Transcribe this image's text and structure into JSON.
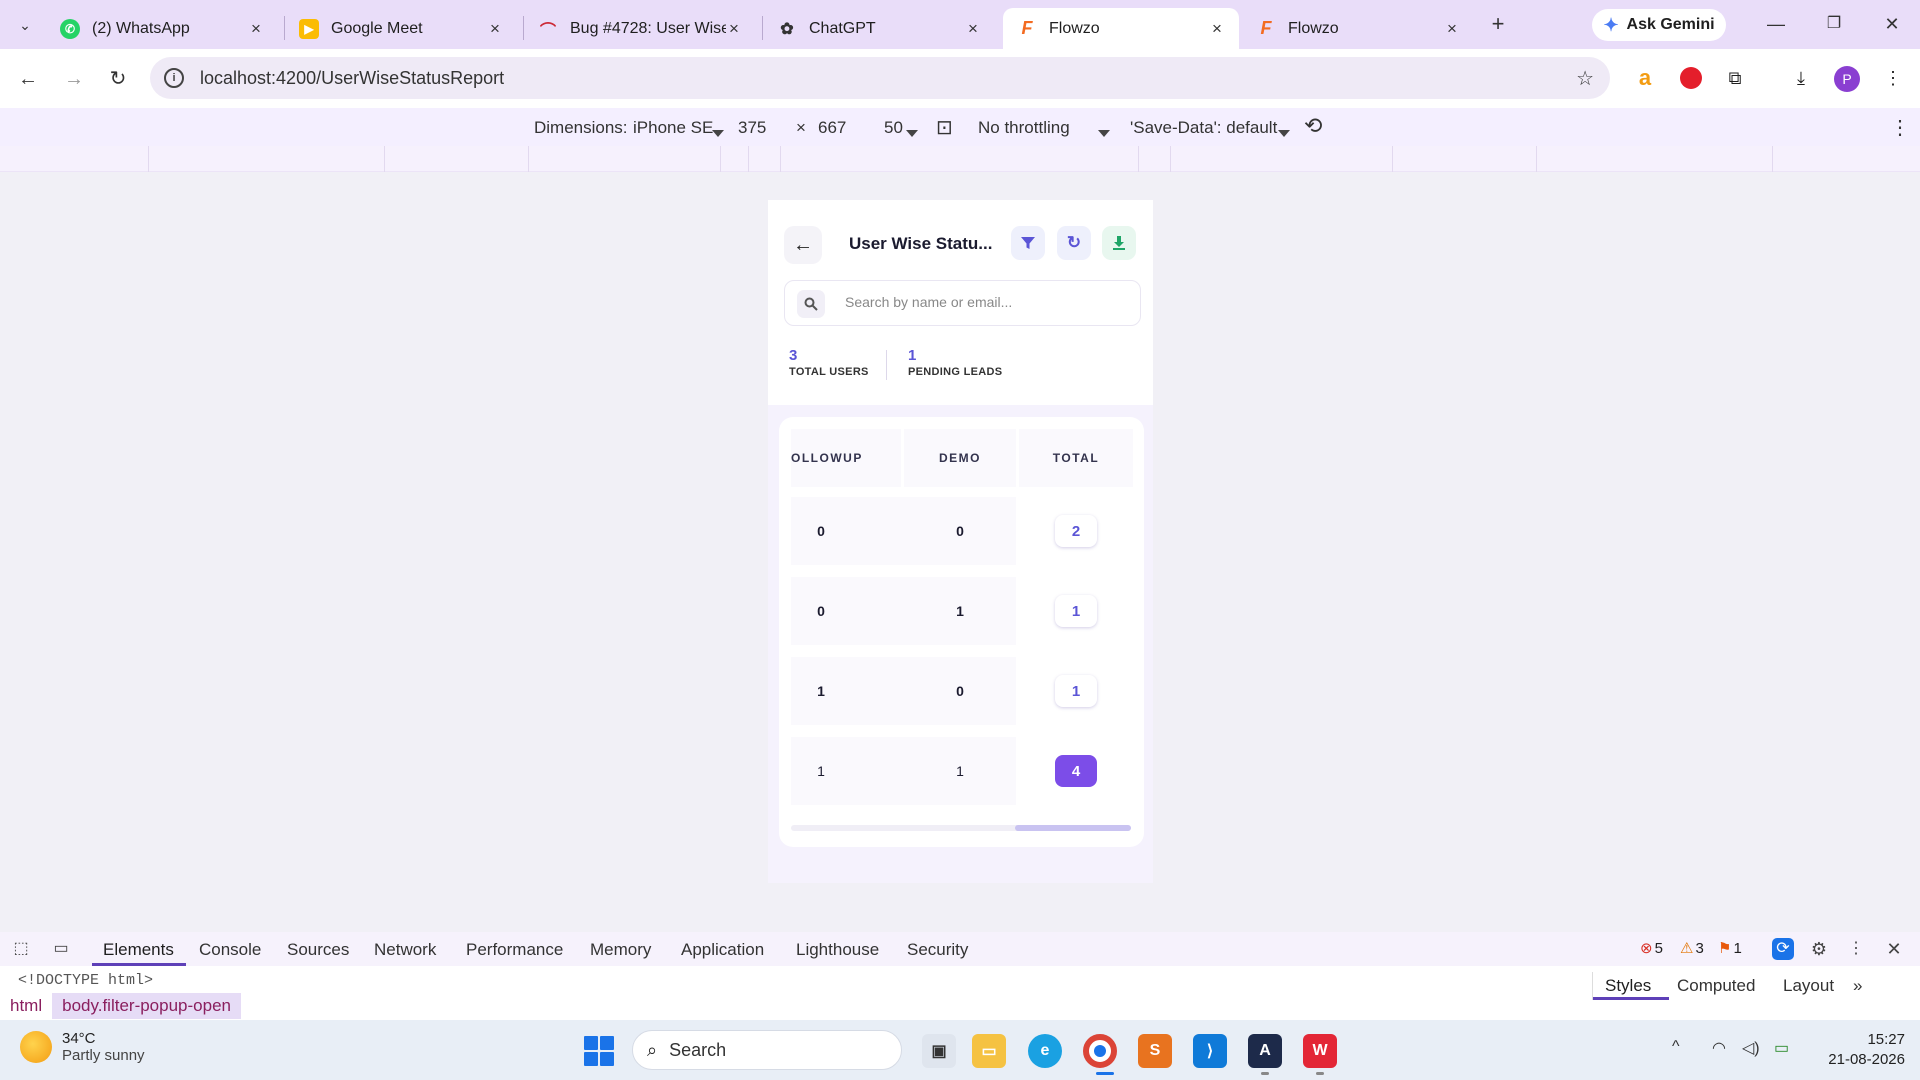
{
  "browser": {
    "tabs": [
      {
        "title": "(2) WhatsApp",
        "icon": "whatsapp-icon",
        "color": "#25d366"
      },
      {
        "title": "Google Meet",
        "icon": "meet-icon",
        "color": "#fbbc04"
      },
      {
        "title": "Bug #4728: User Wise",
        "icon": "azure-devops-icon",
        "color": "#cc2936"
      },
      {
        "title": "ChatGPT",
        "icon": "chatgpt-icon",
        "color": "#333333"
      },
      {
        "title": "Flowzo",
        "icon": "flowzo-icon",
        "color": "#f36b21",
        "active": true
      },
      {
        "title": "Flowzo",
        "icon": "flowzo-icon",
        "color": "#f36b21"
      }
    ],
    "gemini_label": "Ask Gemini",
    "url": "localhost:4200/UserWiseStatusReport"
  },
  "device_toolbar": {
    "dimensions_label": "Dimensions:",
    "device": "iPhone SE",
    "width": "375",
    "times": "×",
    "height": "667",
    "zoom": "50",
    "throttling": "No throttling",
    "save_data": "'Save-Data': default"
  },
  "app": {
    "title": "User Wise Statu...",
    "search_placeholder": "Search by name or email...",
    "stats": [
      {
        "value": "3",
        "label": "TOTAL USERS"
      },
      {
        "value": "1",
        "label": "PENDING LEADS"
      }
    ],
    "table": {
      "columns": [
        "OLLOWUP",
        "DEMO",
        "TOTAL"
      ],
      "rows": [
        {
          "followup": "0",
          "demo": "0",
          "total": "2"
        },
        {
          "followup": "0",
          "demo": "1",
          "total": "1"
        },
        {
          "followup": "1",
          "demo": "0",
          "total": "1"
        },
        {
          "followup": "1",
          "demo": "1",
          "total": "4"
        }
      ]
    },
    "colors": {
      "accent": "#5b55d6",
      "total_highlight": "#7c4de8",
      "refresh": "#5b55d6",
      "download": "#1fa567"
    }
  },
  "devtools": {
    "tabs": [
      "Elements",
      "Console",
      "Sources",
      "Network",
      "Performance",
      "Memory",
      "Application",
      "Lighthouse",
      "Security"
    ],
    "errors": "5",
    "warnings": "3",
    "infos": "1",
    "dom_line": "<!DOCTYPE html>",
    "breadcrumbs": [
      "html",
      "body.filter-popup-open"
    ],
    "style_tabs": [
      "Styles",
      "Computed",
      "Layout"
    ]
  },
  "taskbar": {
    "temperature": "34°C",
    "weather": "Partly sunny",
    "search_placeholder": "Search",
    "time": "15:27",
    "date": "21-08-2026"
  }
}
